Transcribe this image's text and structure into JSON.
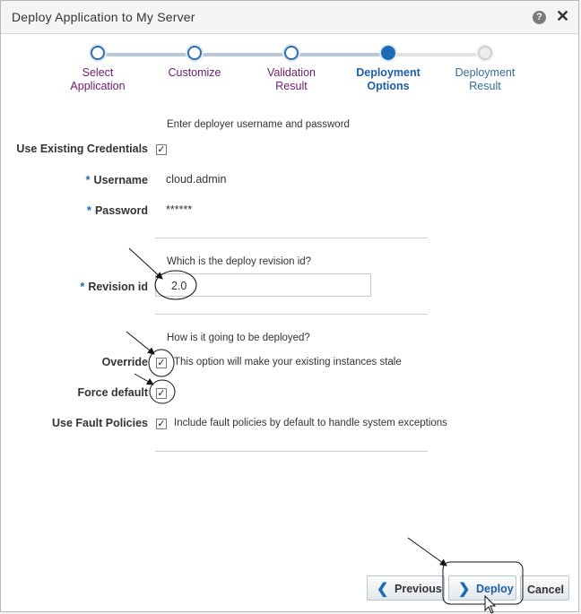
{
  "dialog": {
    "title": "Deploy Application to My Server",
    "help_symbol": "?",
    "close_symbol": "✕"
  },
  "train": {
    "steps": [
      {
        "line1": "Select",
        "line2": "Application",
        "state": "visited"
      },
      {
        "line1": "Customize",
        "line2": "",
        "state": "visited"
      },
      {
        "line1": "Validation",
        "line2": "Result",
        "state": "visited"
      },
      {
        "line1": "Deployment",
        "line2": "Options",
        "state": "current"
      },
      {
        "line1": "Deployment",
        "line2": "Result",
        "state": "future"
      }
    ]
  },
  "credentials": {
    "instruction": "Enter deployer username and password",
    "use_existing_label": "Use Existing Credentials",
    "use_existing_checked": true,
    "username_label": "Username",
    "username_value": "cloud.admin",
    "password_label": "Password",
    "password_value": "******",
    "required_marker": "*"
  },
  "revision": {
    "instruction": "Which is the deploy revision id?",
    "label": "Revision id",
    "value": "2.0",
    "required_marker": "*"
  },
  "deployment": {
    "instruction": "How is it going to be deployed?",
    "override_label": "Override",
    "override_checked": true,
    "override_help": "This option will make your existing instances stale",
    "force_default_label": "Force default",
    "force_default_checked": true,
    "fault_policies_label": "Use Fault Policies",
    "fault_policies_checked": true,
    "fault_policies_help": "Include fault policies by default to handle system exceptions"
  },
  "footer": {
    "previous_label": "Previous",
    "deploy_label": "Deploy",
    "cancel_label": "Cancel"
  },
  "check_symbol": "✓",
  "colors": {
    "accent": "#1c6bb5",
    "visited_step": "#6e1a73",
    "future_step": "#346b9c",
    "text": "#333333"
  }
}
